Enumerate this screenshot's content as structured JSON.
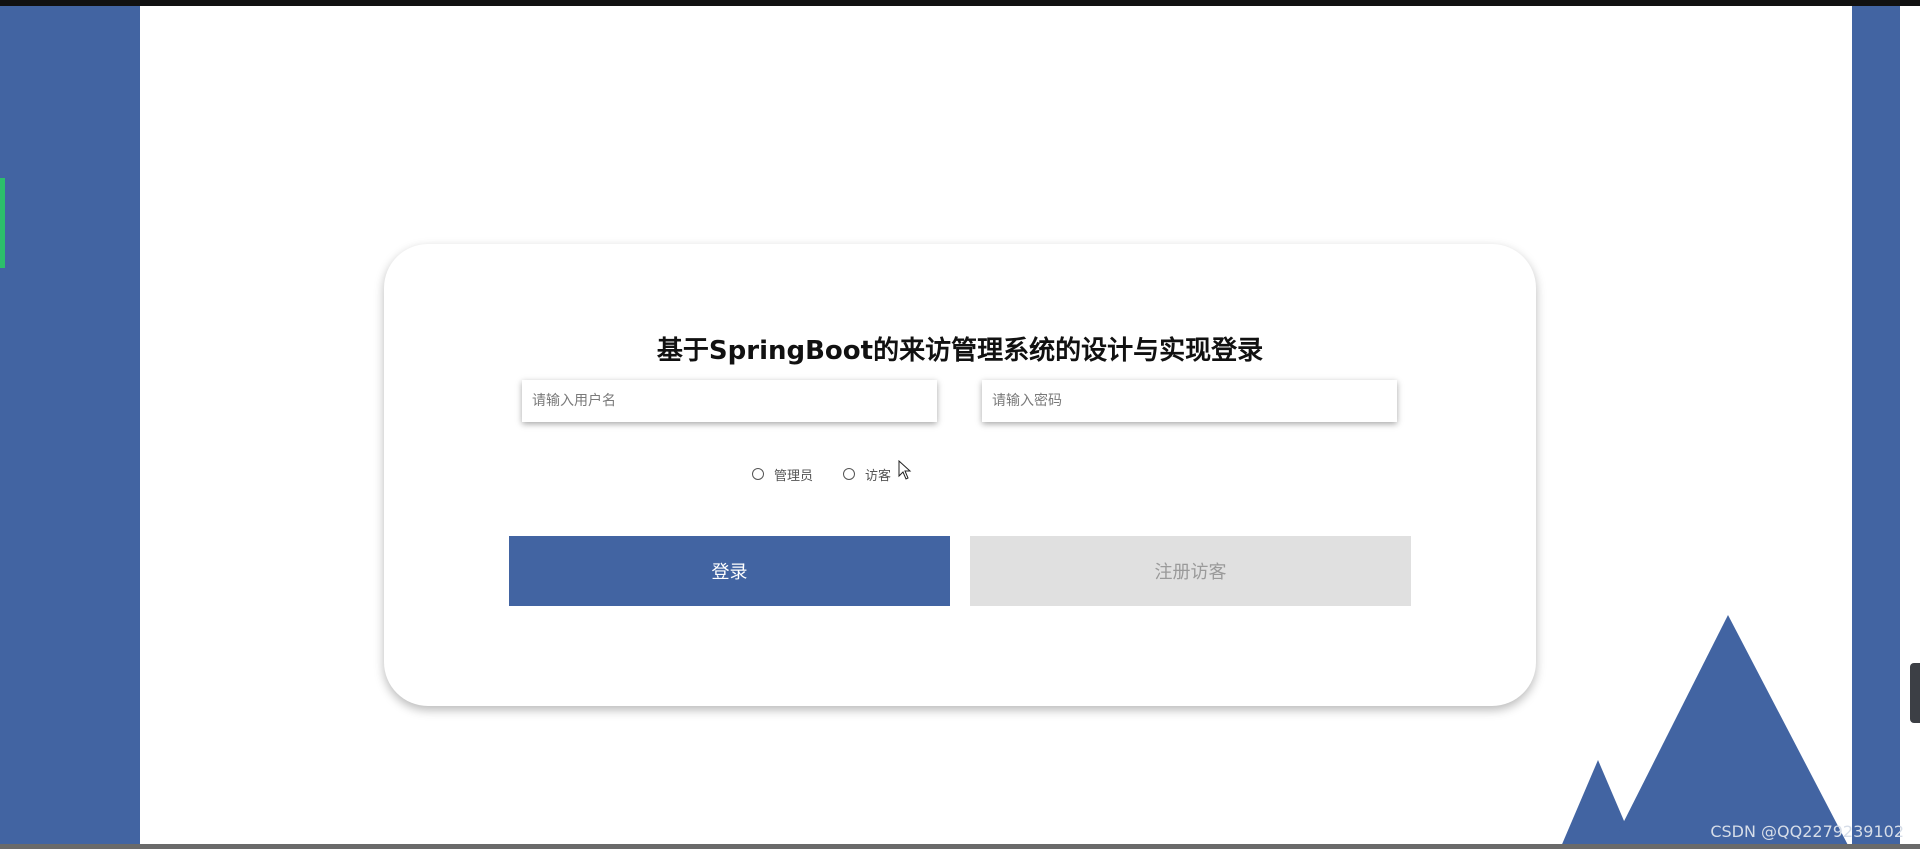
{
  "login": {
    "title": "基于SpringBoot的来访管理系统的设计与实现登录",
    "username_placeholder": "请输入用户名",
    "password_placeholder": "请输入密码",
    "roles": [
      "管理员",
      "访客"
    ],
    "login_label": "登录",
    "register_label": "注册访客"
  },
  "watermark": "CSDN @QQ2279239102",
  "colors": {
    "brand_blue": "#4264a2",
    "accent_green": "#2cbf6b",
    "register_bg": "#e0e0e0",
    "register_text": "#9a9a9a"
  },
  "icons": {
    "cursor": "mouse-cursor-icon",
    "decoration": "mountain-decoration"
  }
}
